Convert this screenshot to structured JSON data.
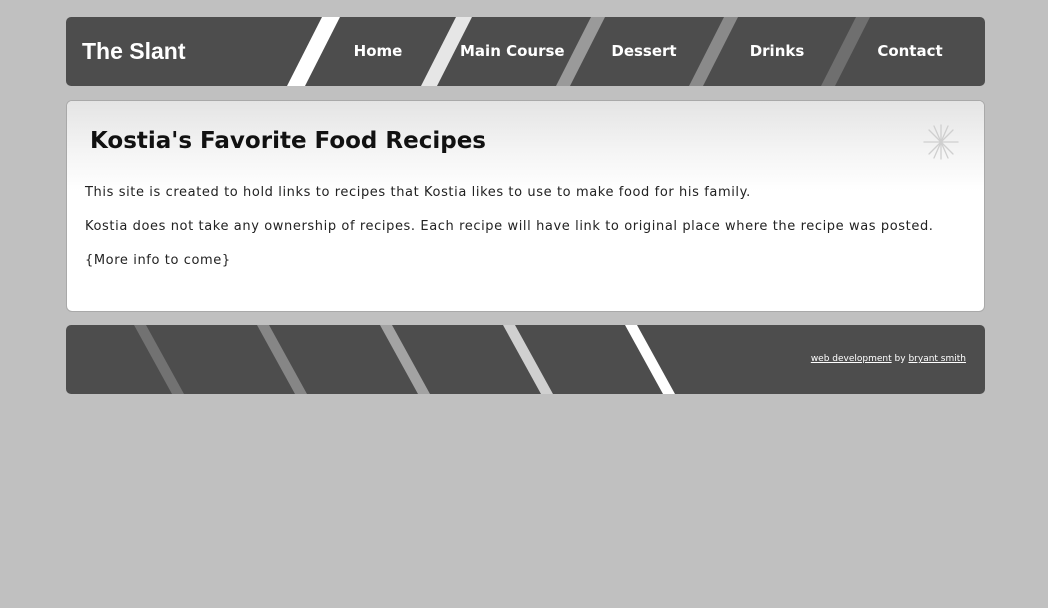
{
  "header": {
    "logo": "The Slant",
    "nav": [
      {
        "label": "Home"
      },
      {
        "label": "Main Course"
      },
      {
        "label": "Dessert"
      },
      {
        "label": "Drinks"
      },
      {
        "label": "Contact"
      }
    ]
  },
  "main": {
    "title": "Kostia's Favorite Food Recipes",
    "paragraphs": [
      "This site is created to hold links to recipes that Kostia likes to use to make food for his family.",
      "Kostia does not take any ownership of recipes. Each recipe will have link to original place where the recipe was posted.",
      "{More info to come}"
    ],
    "decoration_icon": "asterisk-star-icon"
  },
  "footer": {
    "link1": "web development",
    "by": "by",
    "link2": "bryant smith"
  },
  "colors": {
    "page_bg": "#c0c0c0",
    "bar_bg": "#4d4d4d",
    "text_light": "#ffffff",
    "text_dark": "#111111"
  }
}
